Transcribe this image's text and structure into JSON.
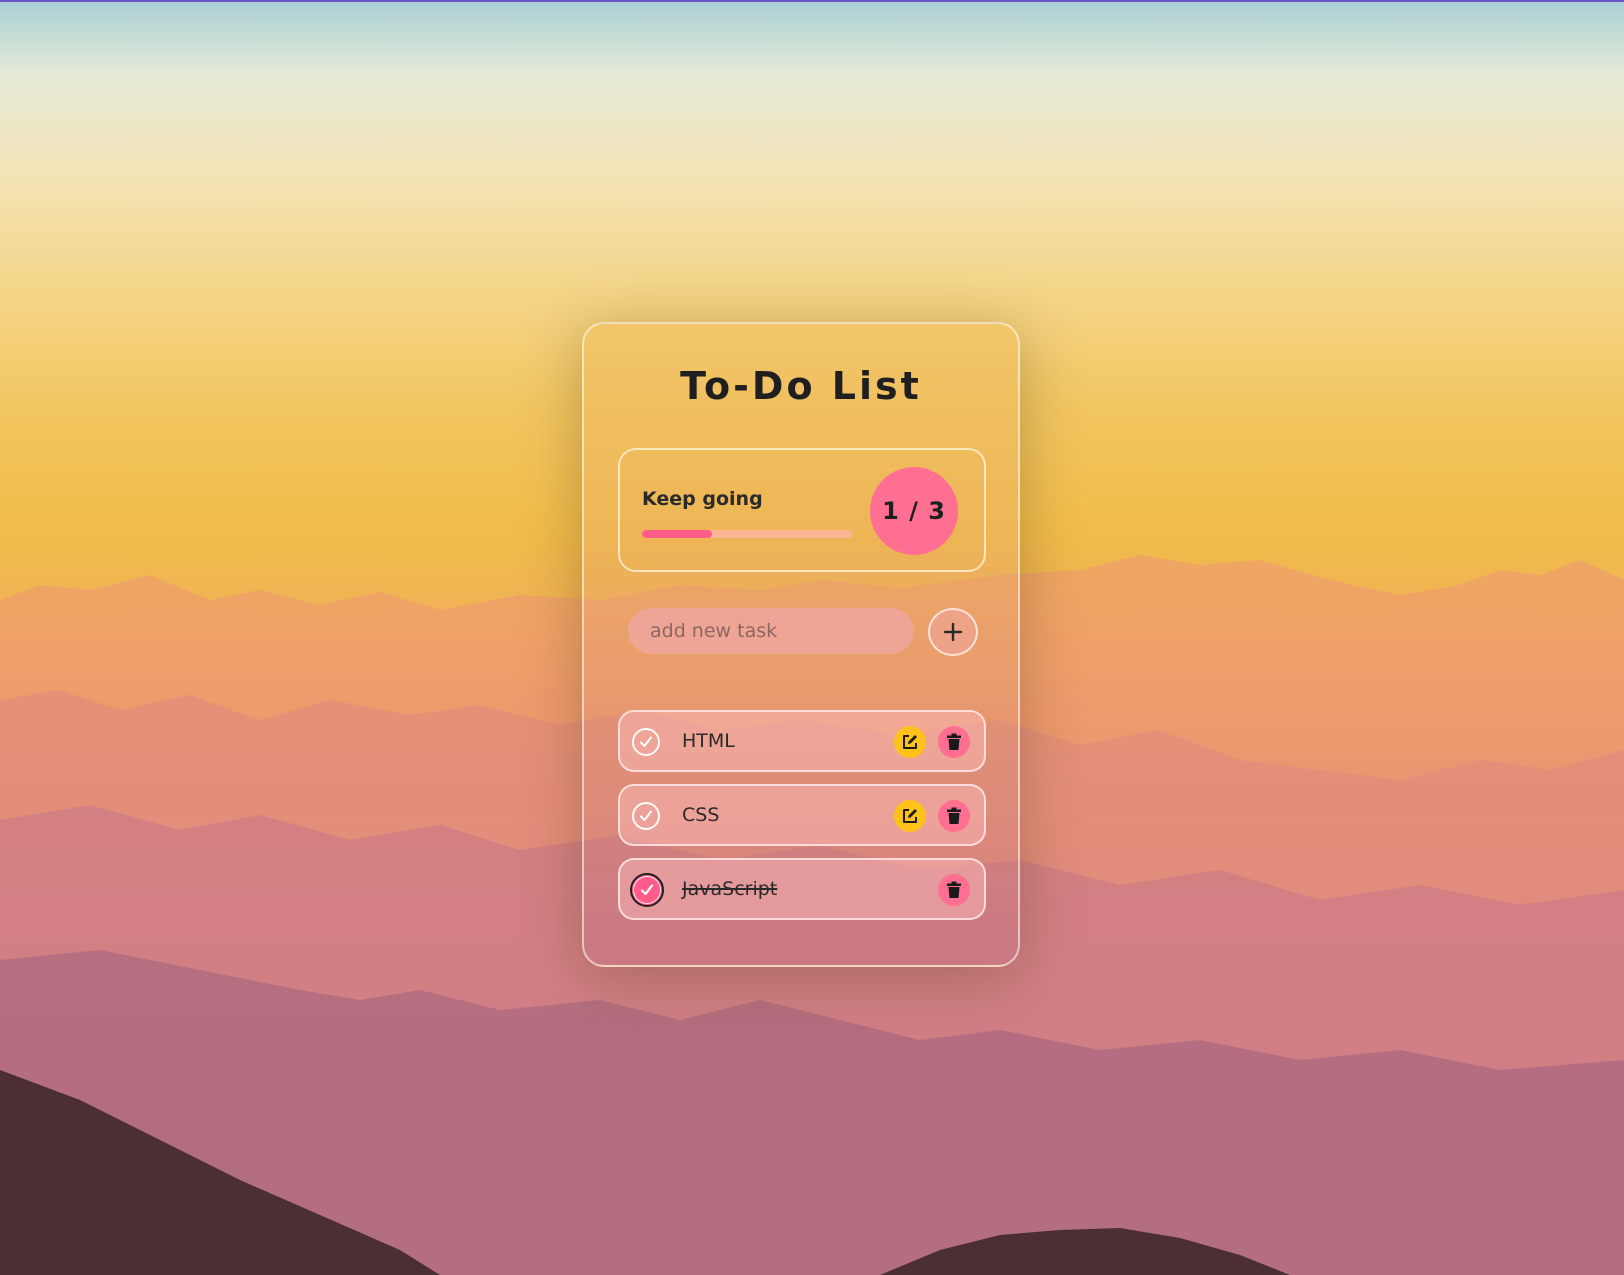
{
  "app": {
    "title": "To-Do List"
  },
  "stats": {
    "label": "Keep going",
    "completed": 1,
    "total": 3,
    "counter_text": "1 / 3",
    "progress_fraction": 0.3333
  },
  "add_task": {
    "placeholder": "add new task",
    "value": ""
  },
  "tasks": [
    {
      "text": "HTML",
      "completed": false,
      "editable": true
    },
    {
      "text": "CSS",
      "completed": false,
      "editable": true
    },
    {
      "text": "JavaScript",
      "completed": true,
      "editable": false
    }
  ],
  "icons": {
    "add": "plus-icon",
    "check": "check-icon",
    "edit": "edit-icon",
    "delete": "trash-icon"
  },
  "colors": {
    "accent": "#ff6f91",
    "progress_fill": "#ff5c8a",
    "edit": "#ffc21a",
    "text": "#1f1f1f"
  }
}
